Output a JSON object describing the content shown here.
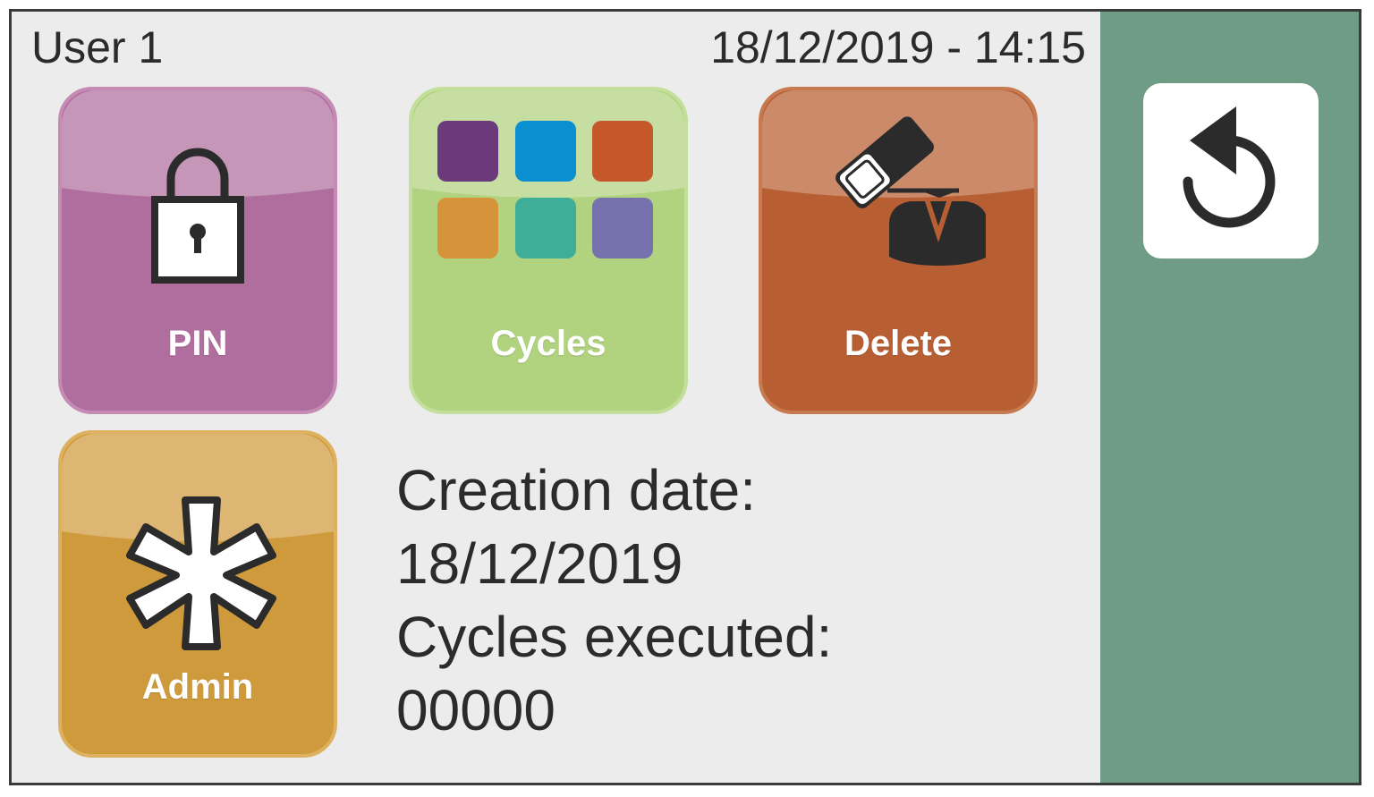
{
  "header": {
    "user": "User 1",
    "datetime": "18/12/2019 - 14:15"
  },
  "tiles": [
    {
      "label": "PIN",
      "icon": "lock-icon",
      "color": "#b06e9f"
    },
    {
      "label": "Cycles",
      "icon": "color-grid-icon",
      "color": "#b1d27e"
    },
    {
      "label": "Delete",
      "icon": "eraser-user-icon",
      "color": "#b75f33"
    },
    {
      "label": "Admin",
      "icon": "asterisk-icon",
      "color": "#cf9a3c"
    }
  ],
  "cycle_swatches": [
    "#6b3a7a",
    "#0a8fd0",
    "#c4582a",
    "#d6943a",
    "#3fae98",
    "#7672ae"
  ],
  "info": {
    "creation_label": "Creation date:",
    "creation_value": "18/12/2019",
    "cycles_label": "Cycles executed:",
    "cycles_value": "00000"
  },
  "side_panel": {
    "back_icon": "back-arrow-icon",
    "color": "#6e9c84"
  }
}
